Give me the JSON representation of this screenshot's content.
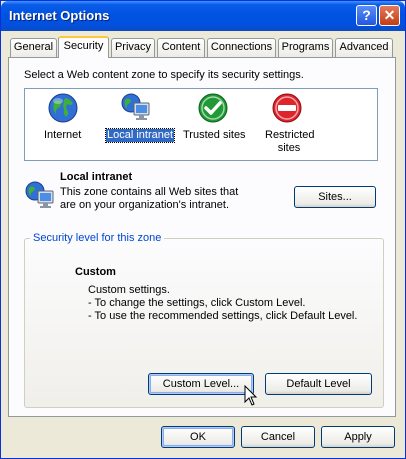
{
  "window": {
    "title": "Internet Options",
    "help_icon": "?",
    "close_icon": "✕"
  },
  "tabs": [
    {
      "label": "General"
    },
    {
      "label": "Security",
      "active": true
    },
    {
      "label": "Privacy"
    },
    {
      "label": "Content"
    },
    {
      "label": "Connections"
    },
    {
      "label": "Programs"
    },
    {
      "label": "Advanced"
    }
  ],
  "security": {
    "instruction": "Select a Web content zone to specify its security settings.",
    "zones": [
      {
        "label": "Internet",
        "icon": "globe-icon"
      },
      {
        "label": "Local intranet",
        "icon": "intranet-icon",
        "selected": true
      },
      {
        "label": "Trusted sites",
        "icon": "checkmark-icon"
      },
      {
        "label": "Restricted sites",
        "icon": "no-entry-icon"
      }
    ],
    "selected_zone": {
      "title": "Local intranet",
      "desc_line1": "This zone contains all Web sites that",
      "desc_line2": "are on your organization's intranet.",
      "sites_button": "Sites..."
    },
    "level_group": {
      "title": "Security level for this zone",
      "level_name": "Custom",
      "line1": "Custom settings.",
      "line2": "- To change the settings, click Custom Level.",
      "line3": "- To use the recommended settings, click Default Level.",
      "custom_button": "Custom Level...",
      "default_button": "Default Level"
    }
  },
  "footer": {
    "ok": "OK",
    "cancel": "Cancel",
    "apply": "Apply"
  },
  "colors": {
    "titlebar": "#0053e1",
    "selection": "#316ac5",
    "group_title": "#0046d5",
    "tab_highlight": "#ffc83c"
  }
}
